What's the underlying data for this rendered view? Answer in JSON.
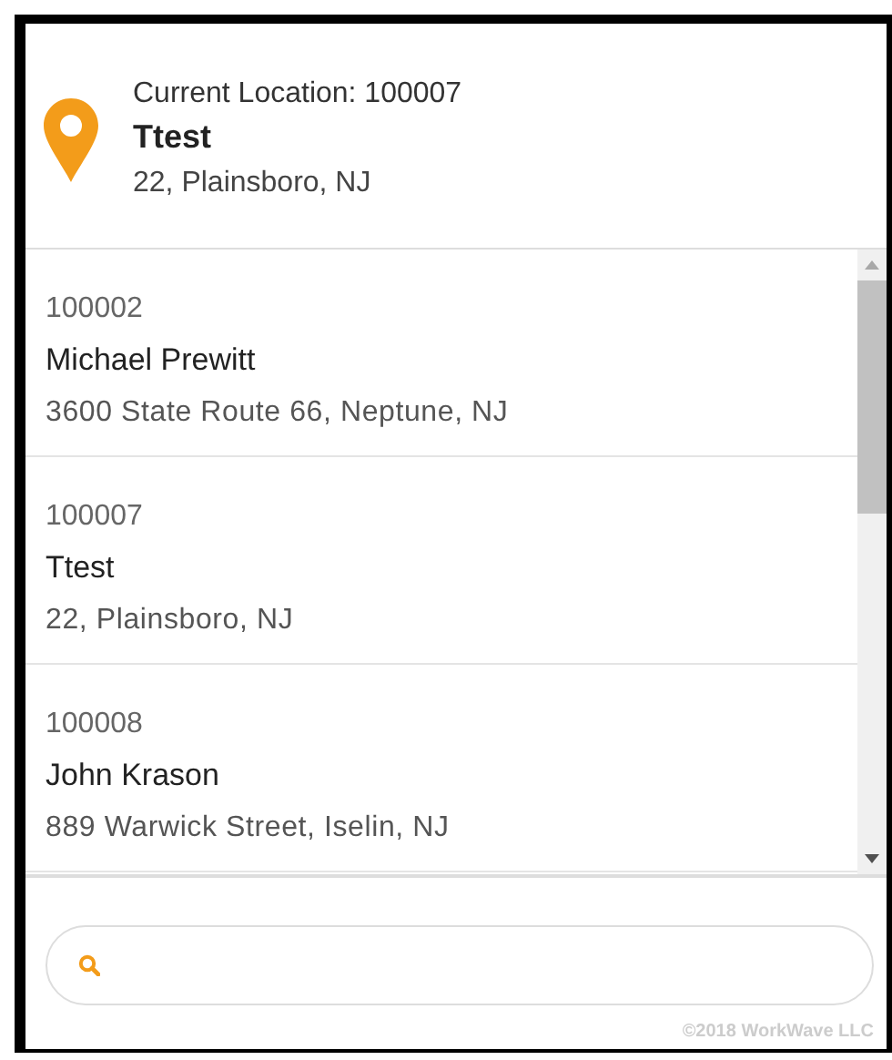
{
  "current_location": {
    "label": "Current Location: 100007",
    "name": "Ttest",
    "address": "22, Plainsboro, NJ"
  },
  "locations": [
    {
      "id": "100002",
      "name": "Michael Prewitt",
      "address": "3600 State Route 66, Neptune, NJ"
    },
    {
      "id": "100007",
      "name": "Ttest",
      "address": "22, Plainsboro, NJ"
    },
    {
      "id": "100008",
      "name": "John Krason",
      "address": "889 Warwick Street, Iselin, NJ"
    }
  ],
  "footer": "©2018 WorkWave LLC"
}
